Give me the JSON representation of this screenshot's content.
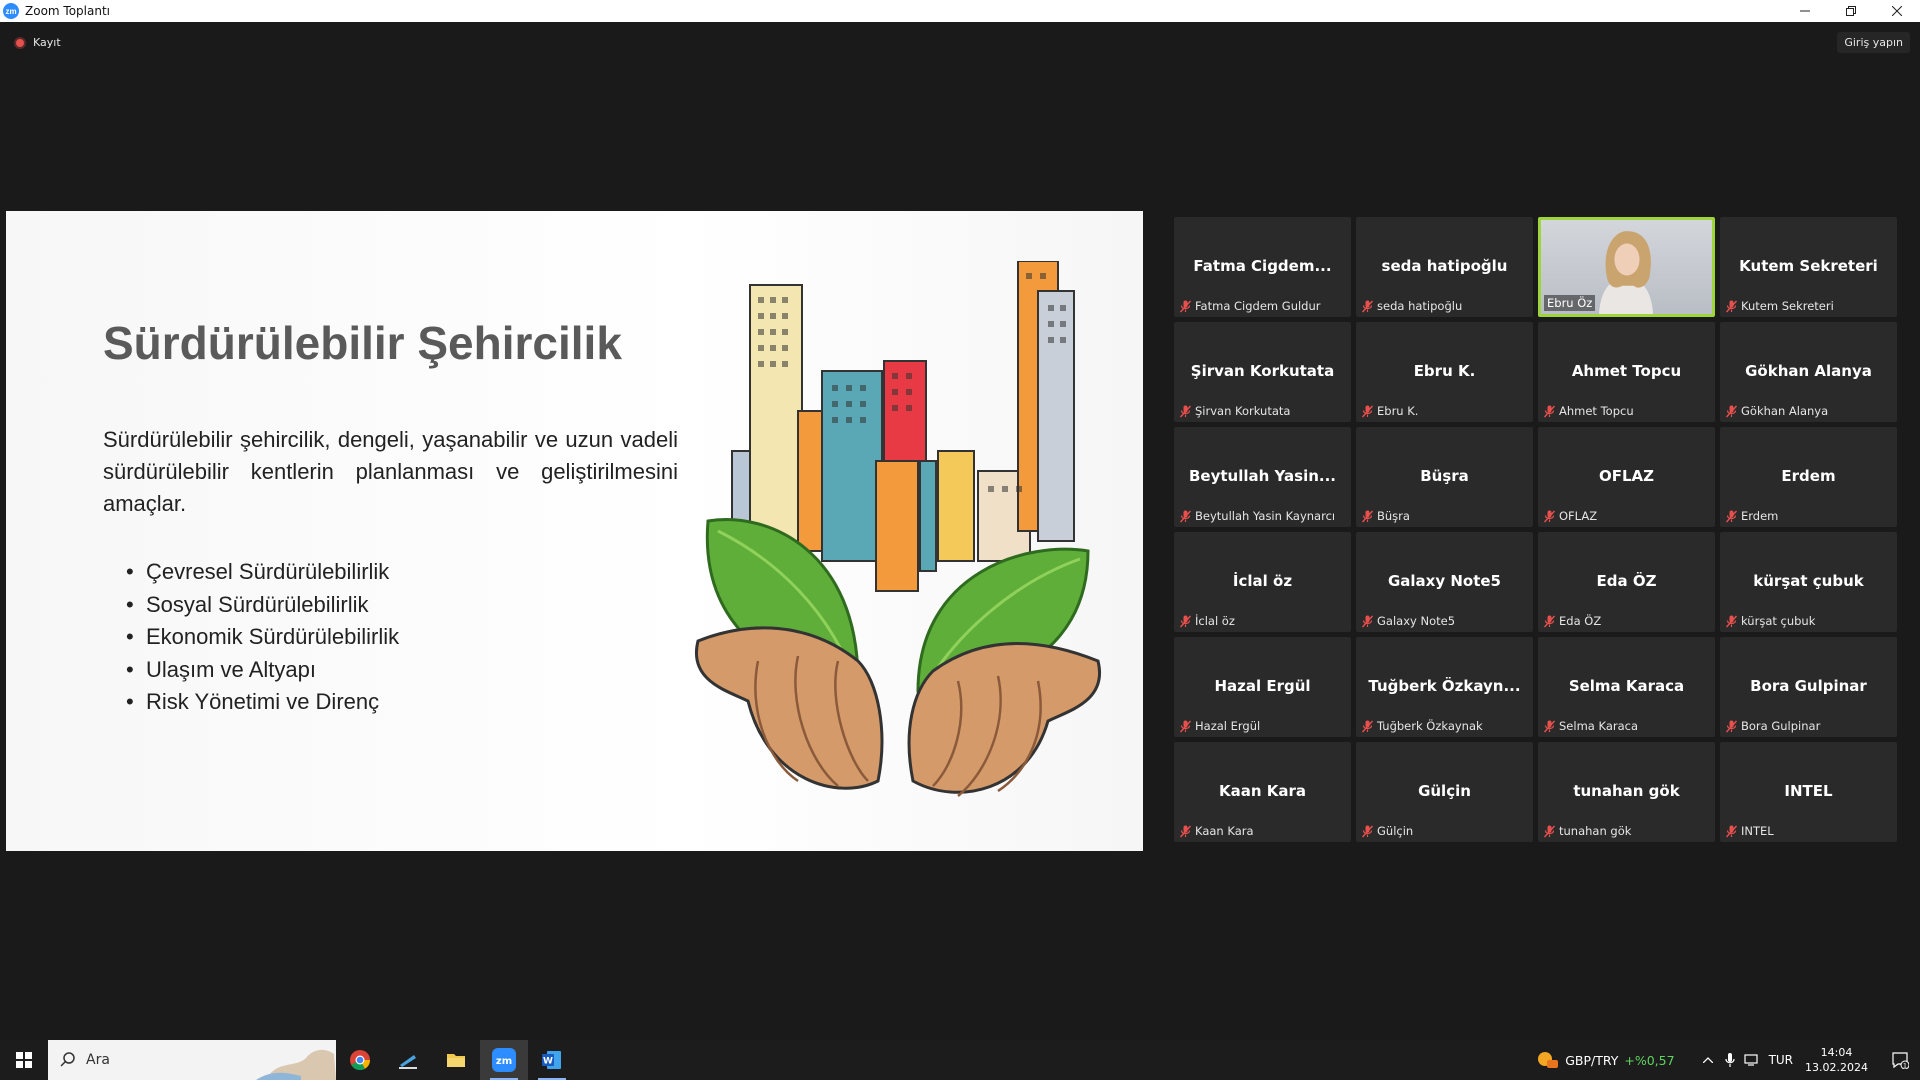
{
  "window": {
    "title": "Zoom Toplantı",
    "app_icon_text": "zm"
  },
  "meeting": {
    "recording_label": "Kayıt",
    "signin_label": "Giriş yapın"
  },
  "slide": {
    "title": "Sürdürülebilir Şehircilik",
    "description": "Sürdürülebilir şehircilik, dengeli, yaşanabilir ve uzun vadeli sürdürülebilir kentlerin planlanması ve geliştirilmesini amaçlar.",
    "bullets": [
      "Çevresel Sürdürülebilirlik",
      "Sosyal Sürdürülebilirlik",
      "Ekonomik Sürdürülebilirlik",
      "Ulaşım ve Altyapı",
      "Risk Yönetimi ve Direnç"
    ]
  },
  "participants": [
    {
      "display": "Fatma Cigdem...",
      "name": "Fatma Cigdem Guldur"
    },
    {
      "display": "seda hatipoğlu",
      "name": "seda hatipoğlu"
    },
    {
      "display": "",
      "name": "Ebru Öz",
      "video": true
    },
    {
      "display": "Kutem Sekreteri",
      "name": "Kutem Sekreteri"
    },
    {
      "display": "Şirvan Korkutata",
      "name": "Şirvan Korkutata"
    },
    {
      "display": "Ebru K.",
      "name": "Ebru K."
    },
    {
      "display": "Ahmet Topcu",
      "name": "Ahmet Topcu"
    },
    {
      "display": "Gökhan Alanya",
      "name": "Gökhan Alanya"
    },
    {
      "display": "Beytullah Yasin...",
      "name": "Beytullah Yasin Kaynarcı"
    },
    {
      "display": "Büşra",
      "name": "Büşra"
    },
    {
      "display": "OFLAZ",
      "name": "OFLAZ"
    },
    {
      "display": "Erdem",
      "name": "Erdem"
    },
    {
      "display": "İclal öz",
      "name": "İclal öz"
    },
    {
      "display": "Galaxy Note5",
      "name": "Galaxy Note5"
    },
    {
      "display": "Eda ÖZ",
      "name": "Eda ÖZ"
    },
    {
      "display": "kürşat çubuk",
      "name": "kürşat çubuk"
    },
    {
      "display": "Hazal Ergül",
      "name": "Hazal Ergül"
    },
    {
      "display": "Tuğberk Özkayn...",
      "name": "Tuğberk Özkaynak"
    },
    {
      "display": "Selma Karaca",
      "name": "Selma Karaca"
    },
    {
      "display": "Bora Gulpinar",
      "name": "Bora Gulpinar"
    },
    {
      "display": "Kaan Kara",
      "name": "Kaan Kara"
    },
    {
      "display": "Gülçin",
      "name": "Gülçin"
    },
    {
      "display": "tunahan gök",
      "name": "tunahan gök"
    },
    {
      "display": "INTEL",
      "name": "INTEL"
    }
  ],
  "taskbar": {
    "search_text": "Ara",
    "zoom_icon_text": "zm",
    "word_icon_text": "W",
    "currency_pair": "GBP/TRY",
    "currency_change": "+%0,57",
    "language": "TUR",
    "time": "14:04",
    "date": "13.02.2024",
    "notification_count": "1"
  },
  "colors": {
    "accent_active_speaker": "#9dd53a",
    "muted_mic": "#e8504d",
    "zoom_blue": "#2d8cff"
  }
}
